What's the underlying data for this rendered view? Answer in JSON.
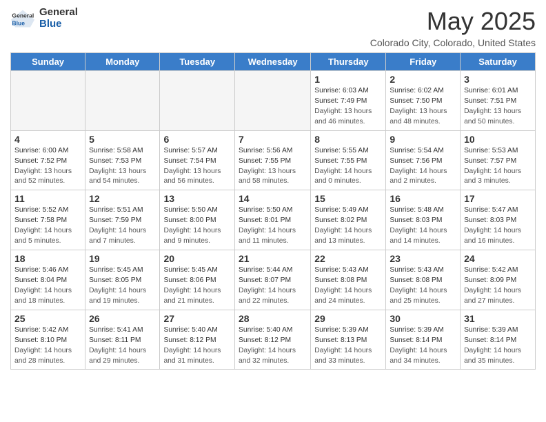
{
  "header": {
    "logo_general": "General",
    "logo_blue": "Blue",
    "month": "May 2025",
    "location": "Colorado City, Colorado, United States"
  },
  "weekdays": [
    "Sunday",
    "Monday",
    "Tuesday",
    "Wednesday",
    "Thursday",
    "Friday",
    "Saturday"
  ],
  "weeks": [
    [
      {
        "day": "",
        "empty": true
      },
      {
        "day": "",
        "empty": true
      },
      {
        "day": "",
        "empty": true
      },
      {
        "day": "",
        "empty": true
      },
      {
        "day": "1",
        "sunrise": "6:03 AM",
        "sunset": "7:49 PM",
        "daylight": "13 hours and 46 minutes."
      },
      {
        "day": "2",
        "sunrise": "6:02 AM",
        "sunset": "7:50 PM",
        "daylight": "13 hours and 48 minutes."
      },
      {
        "day": "3",
        "sunrise": "6:01 AM",
        "sunset": "7:51 PM",
        "daylight": "13 hours and 50 minutes."
      }
    ],
    [
      {
        "day": "4",
        "sunrise": "6:00 AM",
        "sunset": "7:52 PM",
        "daylight": "13 hours and 52 minutes."
      },
      {
        "day": "5",
        "sunrise": "5:58 AM",
        "sunset": "7:53 PM",
        "daylight": "13 hours and 54 minutes."
      },
      {
        "day": "6",
        "sunrise": "5:57 AM",
        "sunset": "7:54 PM",
        "daylight": "13 hours and 56 minutes."
      },
      {
        "day": "7",
        "sunrise": "5:56 AM",
        "sunset": "7:55 PM",
        "daylight": "13 hours and 58 minutes."
      },
      {
        "day": "8",
        "sunrise": "5:55 AM",
        "sunset": "7:55 PM",
        "daylight": "14 hours and 0 minutes."
      },
      {
        "day": "9",
        "sunrise": "5:54 AM",
        "sunset": "7:56 PM",
        "daylight": "14 hours and 2 minutes."
      },
      {
        "day": "10",
        "sunrise": "5:53 AM",
        "sunset": "7:57 PM",
        "daylight": "14 hours and 3 minutes."
      }
    ],
    [
      {
        "day": "11",
        "sunrise": "5:52 AM",
        "sunset": "7:58 PM",
        "daylight": "14 hours and 5 minutes."
      },
      {
        "day": "12",
        "sunrise": "5:51 AM",
        "sunset": "7:59 PM",
        "daylight": "14 hours and 7 minutes."
      },
      {
        "day": "13",
        "sunrise": "5:50 AM",
        "sunset": "8:00 PM",
        "daylight": "14 hours and 9 minutes."
      },
      {
        "day": "14",
        "sunrise": "5:50 AM",
        "sunset": "8:01 PM",
        "daylight": "14 hours and 11 minutes."
      },
      {
        "day": "15",
        "sunrise": "5:49 AM",
        "sunset": "8:02 PM",
        "daylight": "14 hours and 13 minutes."
      },
      {
        "day": "16",
        "sunrise": "5:48 AM",
        "sunset": "8:03 PM",
        "daylight": "14 hours and 14 minutes."
      },
      {
        "day": "17",
        "sunrise": "5:47 AM",
        "sunset": "8:03 PM",
        "daylight": "14 hours and 16 minutes."
      }
    ],
    [
      {
        "day": "18",
        "sunrise": "5:46 AM",
        "sunset": "8:04 PM",
        "daylight": "14 hours and 18 minutes."
      },
      {
        "day": "19",
        "sunrise": "5:45 AM",
        "sunset": "8:05 PM",
        "daylight": "14 hours and 19 minutes."
      },
      {
        "day": "20",
        "sunrise": "5:45 AM",
        "sunset": "8:06 PM",
        "daylight": "14 hours and 21 minutes."
      },
      {
        "day": "21",
        "sunrise": "5:44 AM",
        "sunset": "8:07 PM",
        "daylight": "14 hours and 22 minutes."
      },
      {
        "day": "22",
        "sunrise": "5:43 AM",
        "sunset": "8:08 PM",
        "daylight": "14 hours and 24 minutes."
      },
      {
        "day": "23",
        "sunrise": "5:43 AM",
        "sunset": "8:08 PM",
        "daylight": "14 hours and 25 minutes."
      },
      {
        "day": "24",
        "sunrise": "5:42 AM",
        "sunset": "8:09 PM",
        "daylight": "14 hours and 27 minutes."
      }
    ],
    [
      {
        "day": "25",
        "sunrise": "5:42 AM",
        "sunset": "8:10 PM",
        "daylight": "14 hours and 28 minutes."
      },
      {
        "day": "26",
        "sunrise": "5:41 AM",
        "sunset": "8:11 PM",
        "daylight": "14 hours and 29 minutes."
      },
      {
        "day": "27",
        "sunrise": "5:40 AM",
        "sunset": "8:12 PM",
        "daylight": "14 hours and 31 minutes."
      },
      {
        "day": "28",
        "sunrise": "5:40 AM",
        "sunset": "8:12 PM",
        "daylight": "14 hours and 32 minutes."
      },
      {
        "day": "29",
        "sunrise": "5:39 AM",
        "sunset": "8:13 PM",
        "daylight": "14 hours and 33 minutes."
      },
      {
        "day": "30",
        "sunrise": "5:39 AM",
        "sunset": "8:14 PM",
        "daylight": "14 hours and 34 minutes."
      },
      {
        "day": "31",
        "sunrise": "5:39 AM",
        "sunset": "8:14 PM",
        "daylight": "14 hours and 35 minutes."
      }
    ]
  ],
  "labels": {
    "sunrise": "Sunrise:",
    "sunset": "Sunset:",
    "daylight": "Daylight:"
  }
}
